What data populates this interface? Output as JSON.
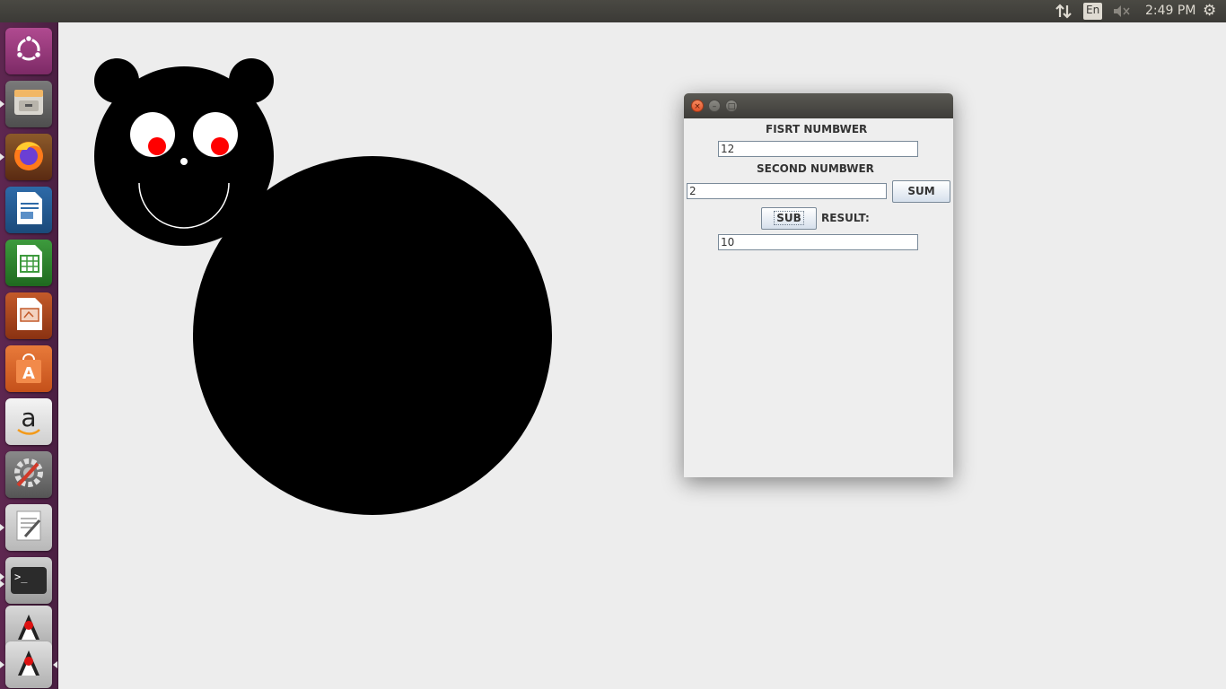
{
  "top_panel": {
    "keyboard_layout": "En",
    "clock": "2:49 PM",
    "icons": [
      "network-updown-icon",
      "sound-muted-icon",
      "session-gear-icon"
    ]
  },
  "launcher": {
    "items": [
      {
        "name": "ubuntu-dash",
        "icon": "ubuntu-logo-icon"
      },
      {
        "name": "files",
        "icon": "file-cabinet-icon"
      },
      {
        "name": "firefox",
        "icon": "firefox-icon"
      },
      {
        "name": "libreoffice-writer",
        "icon": "writer-document-icon"
      },
      {
        "name": "libreoffice-calc",
        "icon": "calc-spreadsheet-icon"
      },
      {
        "name": "libreoffice-impress",
        "icon": "impress-presentation-icon"
      },
      {
        "name": "ubuntu-software",
        "icon": "software-bag-icon"
      },
      {
        "name": "amazon",
        "icon": "amazon-logo-icon",
        "label": "a"
      },
      {
        "name": "system-settings",
        "icon": "settings-wrench-icon"
      },
      {
        "name": "text-editor",
        "icon": "text-editor-icon"
      },
      {
        "name": "terminal",
        "icon": "terminal-icon",
        "label": ">_"
      },
      {
        "name": "java-app-1",
        "icon": "java-duke-icon"
      },
      {
        "name": "java-app-2",
        "icon": "java-duke-icon"
      }
    ]
  },
  "colors": {
    "drawing_fill": "#000000",
    "eye_white": "#ffffff",
    "pupil": "#ff0000",
    "launcher_bg": "#5e2750",
    "desktop_bg": "#ededed"
  },
  "calculator_window": {
    "first_label": "FISRT NUMBWER",
    "first_value": "12",
    "second_label": "SECOND NUMBWER",
    "second_value": "2",
    "sum_button": "SUM",
    "sub_button": "SUB",
    "result_label": "RESULT:",
    "result_value": "10",
    "close_glyph": "×",
    "minimize_glyph": "–",
    "maximize_glyph": "□"
  }
}
